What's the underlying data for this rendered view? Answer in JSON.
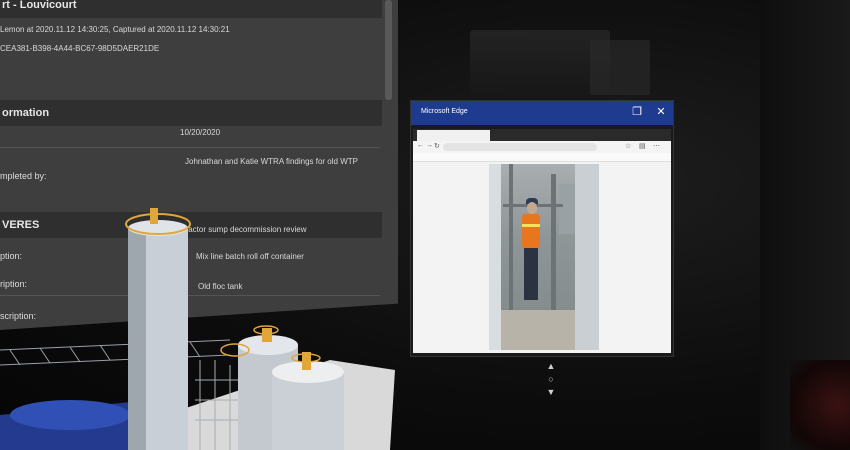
{
  "info_panel": {
    "header_title": "rt - Louvicourt",
    "capture_line": "Lemon at 2020.11.12 14:30:25, Captured at 2020.11.12 14:30:21",
    "id_line": "CEA381-B398-4A44-BC67-98D5DAER21DE",
    "section_information": "ormation",
    "date_value": "10/20/2020",
    "completed_by_label": "mpleted by:",
    "completed_by_value": "Johnathan and Katie WTRA findings for old WTP",
    "section_deliverables": "VERES",
    "rows": [
      {
        "label": "ption:",
        "value": "Reactor sump decommission review"
      },
      {
        "label": "ription:",
        "value": "Mix line batch roll off container"
      },
      {
        "label": "scription:",
        "value": "Old floc tank"
      }
    ]
  },
  "browser": {
    "title": "Microsoft Edge",
    "tab_label": "",
    "url": "",
    "favorites": ""
  },
  "scroll_controls": {
    "up": "▲",
    "center": "○",
    "down": "▼"
  },
  "colors": {
    "titlebar": "#1f3b8f",
    "panel_bg": "#3e3e3e",
    "panel_header": "#2f2f2f",
    "accent_orange": "#e0a63a",
    "plant_blue": "#2a3f9a"
  }
}
